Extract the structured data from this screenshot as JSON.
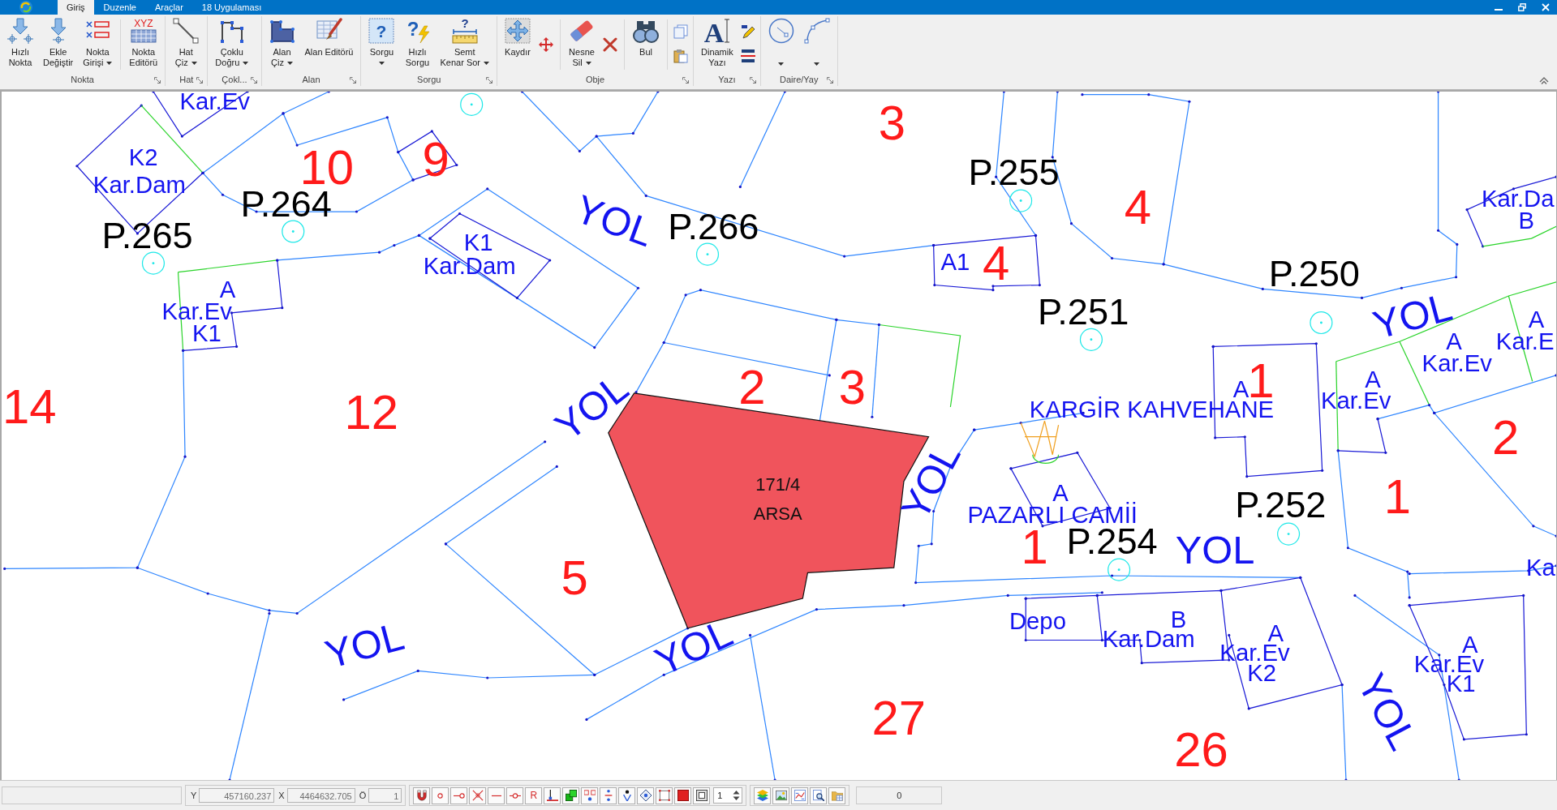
{
  "ribbon": {
    "tabs": [
      {
        "label": "Giriş",
        "selected": true
      },
      {
        "label": "Duzenle",
        "selected": false
      },
      {
        "label": "Araçlar",
        "selected": false
      },
      {
        "label": "18 Uygulaması",
        "selected": false
      }
    ],
    "groups": [
      {
        "label": "Nokta",
        "launcher": true,
        "buttons": [
          {
            "kind": "large",
            "lines": [
              "Hızlı",
              "Nokta"
            ],
            "menu": false
          },
          {
            "kind": "large",
            "lines": [
              "Ekle",
              "Değiştir"
            ],
            "menu": false
          },
          {
            "kind": "large",
            "lines": [
              "Nokta",
              "Girişi"
            ],
            "menu": true
          },
          {
            "kind": "divider"
          },
          {
            "kind": "large",
            "lines": [
              "Nokta",
              "Editörü"
            ],
            "menu": false,
            "icon_text": "XYZ"
          }
        ]
      },
      {
        "label": "Hat",
        "launcher": true,
        "buttons": [
          {
            "kind": "large",
            "lines": [
              "Hat",
              "Çiz"
            ],
            "menu": true
          }
        ]
      },
      {
        "label": "Çokl...",
        "launcher": true,
        "buttons": [
          {
            "kind": "large",
            "lines": [
              "Çoklu",
              "Doğru"
            ],
            "menu": true
          }
        ]
      },
      {
        "label": "Alan",
        "launcher": true,
        "buttons": [
          {
            "kind": "large",
            "lines": [
              "Alan",
              "Çiz"
            ],
            "menu": true
          },
          {
            "kind": "large",
            "lines": [
              "Alan Editörü"
            ],
            "menu": false
          }
        ]
      },
      {
        "label": "Sorgu",
        "launcher": true,
        "buttons": [
          {
            "kind": "large",
            "lines": [
              "Sorgu"
            ],
            "menu": true,
            "icon_text": "?"
          },
          {
            "kind": "large",
            "lines": [
              "Hızlı",
              "Sorgu"
            ],
            "menu": false,
            "icon_text": "?"
          },
          {
            "kind": "large",
            "lines": [
              "Semt",
              "Kenar Sor"
            ],
            "menu": true,
            "icon_text": "?"
          }
        ]
      },
      {
        "label": "Obje",
        "launcher": true,
        "buttons": [
          {
            "kind": "large",
            "lines": [
              "Kaydır"
            ],
            "menu": false
          },
          {
            "kind": "small"
          },
          {
            "kind": "divider"
          },
          {
            "kind": "large",
            "lines": [
              "Nesne",
              "Sil"
            ],
            "menu": true
          },
          {
            "kind": "small"
          },
          {
            "kind": "divider"
          },
          {
            "kind": "large",
            "lines": [
              "Bul"
            ],
            "menu": false
          },
          {
            "kind": "divider"
          },
          {
            "kind": "stack"
          }
        ]
      },
      {
        "label": "Yazı",
        "launcher": true,
        "buttons": [
          {
            "kind": "large",
            "lines": [
              "Dinamik",
              "Yazı"
            ],
            "menu": false,
            "icon_text": "A"
          },
          {
            "kind": "stack"
          }
        ]
      },
      {
        "label": "Daire/Yay",
        "launcher": true,
        "buttons": [
          {
            "kind": "large",
            "menu": true
          },
          {
            "kind": "large",
            "menu": true
          }
        ]
      }
    ]
  },
  "map": {
    "parcel_numbers": [
      "3",
      "10",
      "9",
      "4",
      "4",
      "14",
      "12",
      "2",
      "3",
      "1",
      "2",
      "1",
      "1",
      "5",
      "27",
      "26"
    ],
    "block_labels": [
      "P.255",
      "P.264",
      "P.266",
      "P.265",
      "P.250",
      "P.251",
      "P.252",
      "P.254"
    ],
    "building_labels": [
      "Kar.Ev",
      "K2",
      "Kar.Dam",
      "Kar.Da",
      "B",
      "K1",
      "Kar.Dam",
      "A1",
      "A",
      "Kar.Ev",
      "K1",
      "A",
      "A",
      "Kar.E",
      "Kar.Ev",
      "A",
      "Kar.Ev",
      "A",
      "A",
      "Ka",
      "B",
      "Kar.Dam",
      "A",
      "Kar.Ev",
      "K2",
      "A",
      "Kar.Ev",
      "K1"
    ],
    "place_names": [
      "KARGİR KAHVEHANE",
      "PAZARLI CAMİİ",
      "Depo"
    ],
    "road_labels": [
      "YOL",
      "YOL",
      "YOL",
      "YOL",
      "YOL",
      "YOL",
      "YOL",
      "YOL"
    ],
    "selected_parcel": {
      "number": "171/4",
      "type": "ARSA",
      "selected": true
    }
  },
  "status_bar": {
    "coordinates": [
      {
        "label": "Y",
        "value": "457160.237"
      },
      {
        "label": "X",
        "value": "4464632.705"
      },
      {
        "label": "Ö",
        "value": "1"
      }
    ],
    "tool_glyph": "R",
    "spin_value": "1",
    "count": "0"
  }
}
